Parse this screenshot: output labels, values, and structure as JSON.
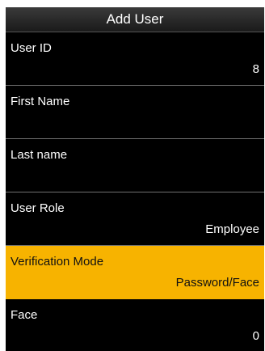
{
  "header": {
    "title": "Add User"
  },
  "items": [
    {
      "label": "User ID",
      "value": "8"
    },
    {
      "label": "First Name",
      "value": ""
    },
    {
      "label": "Last name",
      "value": ""
    },
    {
      "label": "User Role",
      "value": "Employee"
    },
    {
      "label": "Verification Mode",
      "value": "Password/Face"
    },
    {
      "label": "Face",
      "value": "0"
    }
  ],
  "colors": {
    "highlight": "#f7b300",
    "background": "#000000",
    "divider": "#707070"
  }
}
